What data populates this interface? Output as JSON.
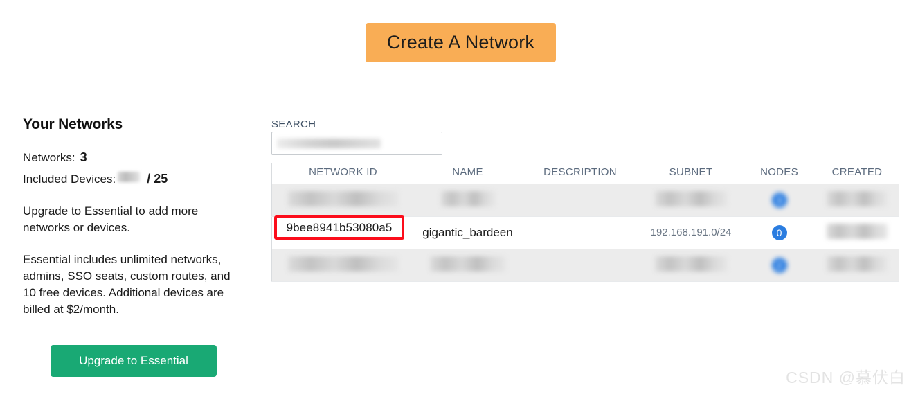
{
  "header": {
    "create_button_label": "Create A Network"
  },
  "sidebar": {
    "title": "Your Networks",
    "networks_label": "Networks:",
    "networks_count": "3",
    "included_devices_label": "Included Devices:",
    "included_devices_value": "",
    "included_devices_total": "/ 25",
    "upgrade_paragraph": "Upgrade to Essential to add more networks or devices.",
    "essential_paragraph": "Essential includes unlimited networks, admins, SSO seats, custom routes, and 10 free devices. Additional devices are billed at $2/month.",
    "upgrade_button_label": "Upgrade to Essential"
  },
  "search": {
    "label": "SEARCH",
    "value": "",
    "placeholder": ""
  },
  "table": {
    "columns": [
      "NETWORK ID",
      "NAME",
      "DESCRIPTION",
      "SUBNET",
      "NODES",
      "CREATED"
    ],
    "rows": [
      {
        "network_id": "",
        "name": "",
        "description": "",
        "subnet": "",
        "nodes": "",
        "created": "",
        "redacted": true
      },
      {
        "network_id": "9bee8941b53080a5",
        "name": "gigantic_bardeen",
        "description": "",
        "subnet": "192.168.191.0/24",
        "nodes": "0",
        "created": "",
        "redacted": false
      },
      {
        "network_id": "",
        "name": "",
        "description": "",
        "subnet": "",
        "nodes": "",
        "created": "",
        "redacted": true
      }
    ]
  },
  "highlight": {
    "network_id": "9bee8941b53080a5",
    "color": "#fc0d1b"
  },
  "colors": {
    "create_button": "#f9ad55",
    "upgrade_button": "#19a974",
    "node_badge": "#2b7de0",
    "header_text": "#5c6b7e"
  },
  "watermark": {
    "text": "CSDN @慕伏白"
  }
}
